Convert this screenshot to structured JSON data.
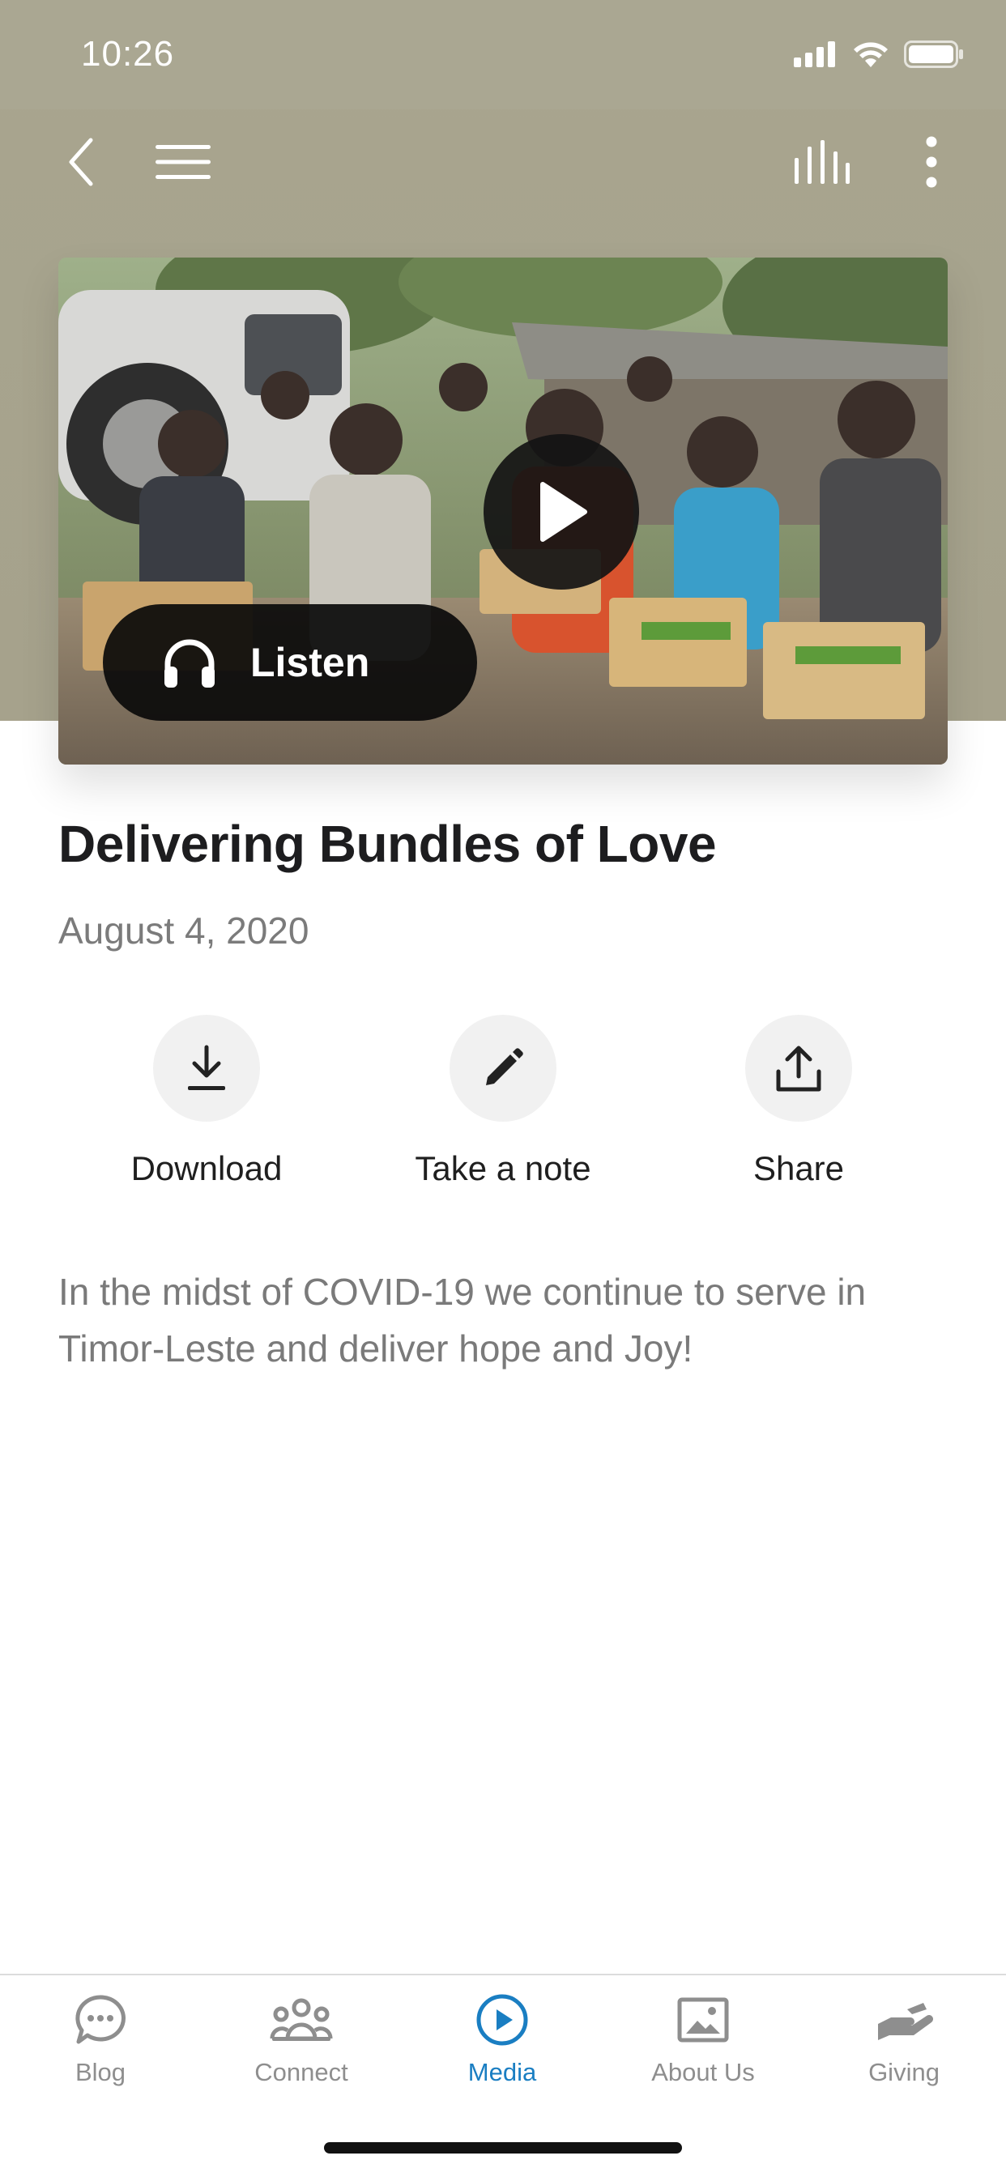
{
  "status_bar": {
    "time": "10:26"
  },
  "nav": {
    "back_icon": "chevron-left-icon",
    "menu_icon": "hamburger-menu-icon",
    "audio_icon": "audio-bars-icon",
    "more_icon": "more-vertical-icon"
  },
  "media": {
    "listen_label": "Listen",
    "play_icon": "play-icon",
    "headphones_icon": "headphones-icon"
  },
  "article": {
    "title": "Delivering Bundles of Love",
    "date": "August 4, 2020",
    "description": "In the midst of COVID-19 we continue to serve in Timor-Leste and deliver hope and Joy!"
  },
  "actions": [
    {
      "label": "Download",
      "icon": "download-icon"
    },
    {
      "label": "Take a note",
      "icon": "pencil-icon"
    },
    {
      "label": "Share",
      "icon": "share-icon"
    }
  ],
  "tabbar": {
    "tabs": [
      {
        "label": "Blog",
        "icon": "chat-bubble-icon",
        "active": false
      },
      {
        "label": "Connect",
        "icon": "people-icon",
        "active": false
      },
      {
        "label": "Media",
        "icon": "play-circle-icon",
        "active": true
      },
      {
        "label": "About Us",
        "icon": "image-icon",
        "active": false
      },
      {
        "label": "Giving",
        "icon": "giving-hand-icon",
        "active": false
      }
    ]
  },
  "colors": {
    "header_bg": "#a8a58f",
    "accent": "#1a7ec2",
    "tab_inactive": "#8e8e8e"
  }
}
